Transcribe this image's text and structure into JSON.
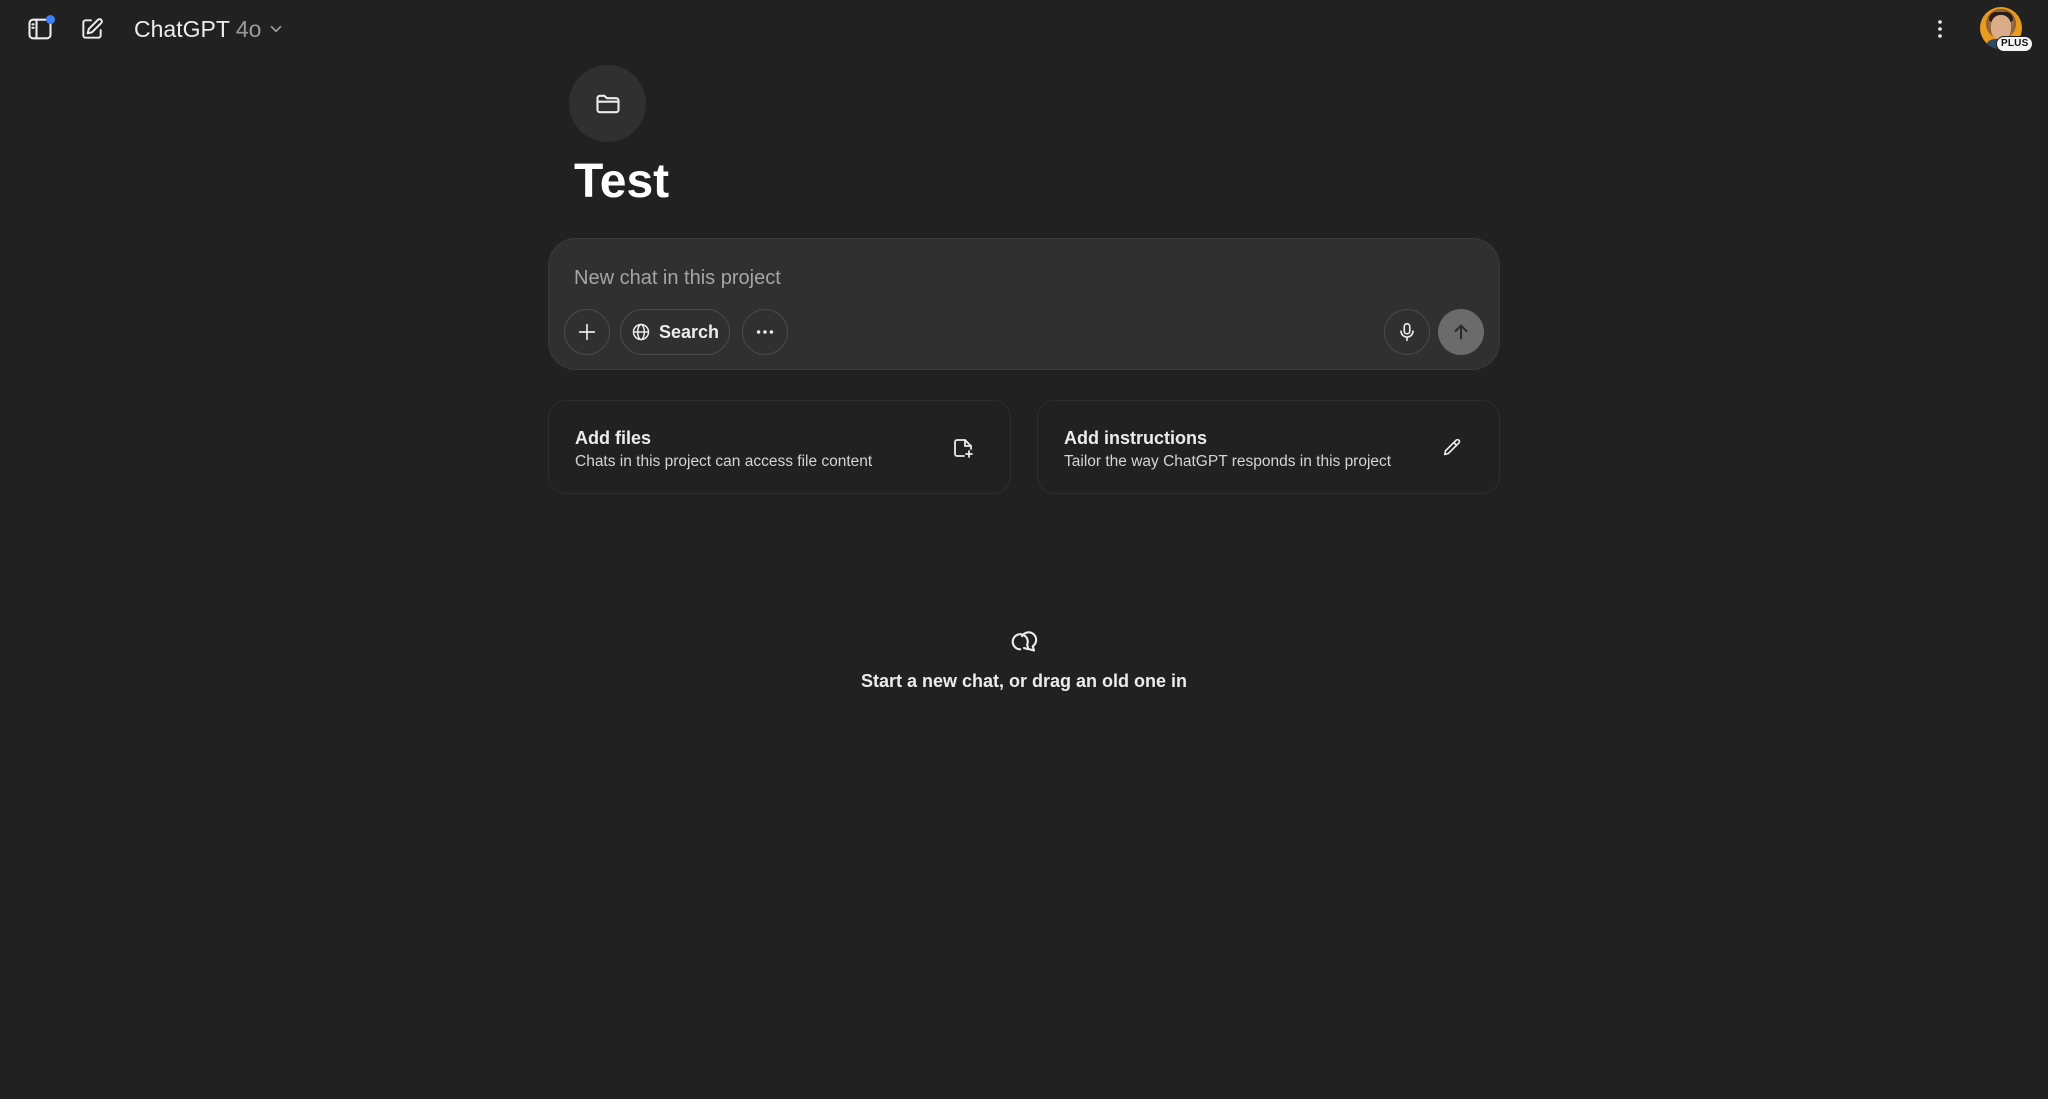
{
  "header": {
    "model_name": "ChatGPT",
    "model_version": "4o",
    "plan_badge": "PLUS"
  },
  "project": {
    "title": "Test"
  },
  "composer": {
    "placeholder": "New chat in this project",
    "search_label": "Search"
  },
  "cards": [
    {
      "title": "Add files",
      "subtitle": "Chats in this project can access file content",
      "icon": "file-plus-icon"
    },
    {
      "title": "Add instructions",
      "subtitle": "Tailor the way ChatGPT responds in this project",
      "icon": "pencil-icon"
    }
  ],
  "empty_state": {
    "text": "Start a new chat, or drag an old one in",
    "icon": "chat-bubbles-icon"
  },
  "colors": {
    "background": "#212121",
    "composer": "#303030",
    "notification_dot": "#3b82f6",
    "send_button": "#6b6b6b"
  }
}
